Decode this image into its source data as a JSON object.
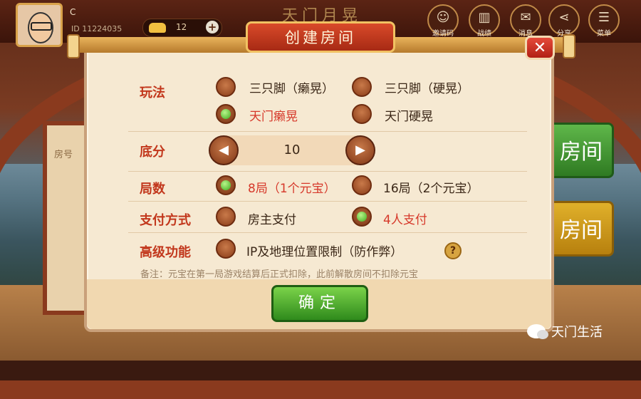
{
  "top_bar": {
    "player_name": "C          ",
    "player_id": "ID  11224035",
    "gold_count": "12",
    "add_label": "+",
    "logo_text": "天门月晃",
    "buttons": [
      {
        "icon": "person-icon",
        "label": "邀请码"
      },
      {
        "icon": "bar-chart-icon",
        "label": "战绩"
      },
      {
        "icon": "mail-icon",
        "label": "消息"
      },
      {
        "icon": "share-icon",
        "label": "分享"
      },
      {
        "icon": "menu-icon",
        "label": "菜单"
      }
    ]
  },
  "background": {
    "left_board_text": "房号",
    "side_button_top": "房间",
    "side_button_bottom": "房间"
  },
  "dialog": {
    "title": "创建房间",
    "close_label": "✕",
    "rows": {
      "play_mode": {
        "label": "玩法",
        "options": [
          {
            "text": "三只脚（癞晃）",
            "selected": false
          },
          {
            "text": "三只脚（硬晃）",
            "selected": false
          },
          {
            "text": "天门癞晃",
            "selected": true
          },
          {
            "text": "天门硬晃",
            "selected": false
          }
        ]
      },
      "base_score": {
        "label": "底分",
        "value": "10",
        "decrease": "◀",
        "increase": "▶"
      },
      "rounds": {
        "label": "局数",
        "options": [
          {
            "text": "8局（1个元宝）",
            "selected": true
          },
          {
            "text": "16局（2个元宝）",
            "selected": false
          }
        ]
      },
      "payment": {
        "label": "支付方式",
        "options": [
          {
            "text": "房主支付",
            "selected": false
          },
          {
            "text": "4人支付",
            "selected": true
          }
        ]
      },
      "advanced": {
        "label": "高级功能",
        "option": {
          "text": "IP及地理位置限制（防作弊）",
          "selected": false
        },
        "help": "?"
      }
    },
    "note": "备注：元宝在第一局游戏结算后正式扣除，此前解散房间不扣除元宝",
    "confirm_label": "确定"
  },
  "watermark": "天门生活"
}
